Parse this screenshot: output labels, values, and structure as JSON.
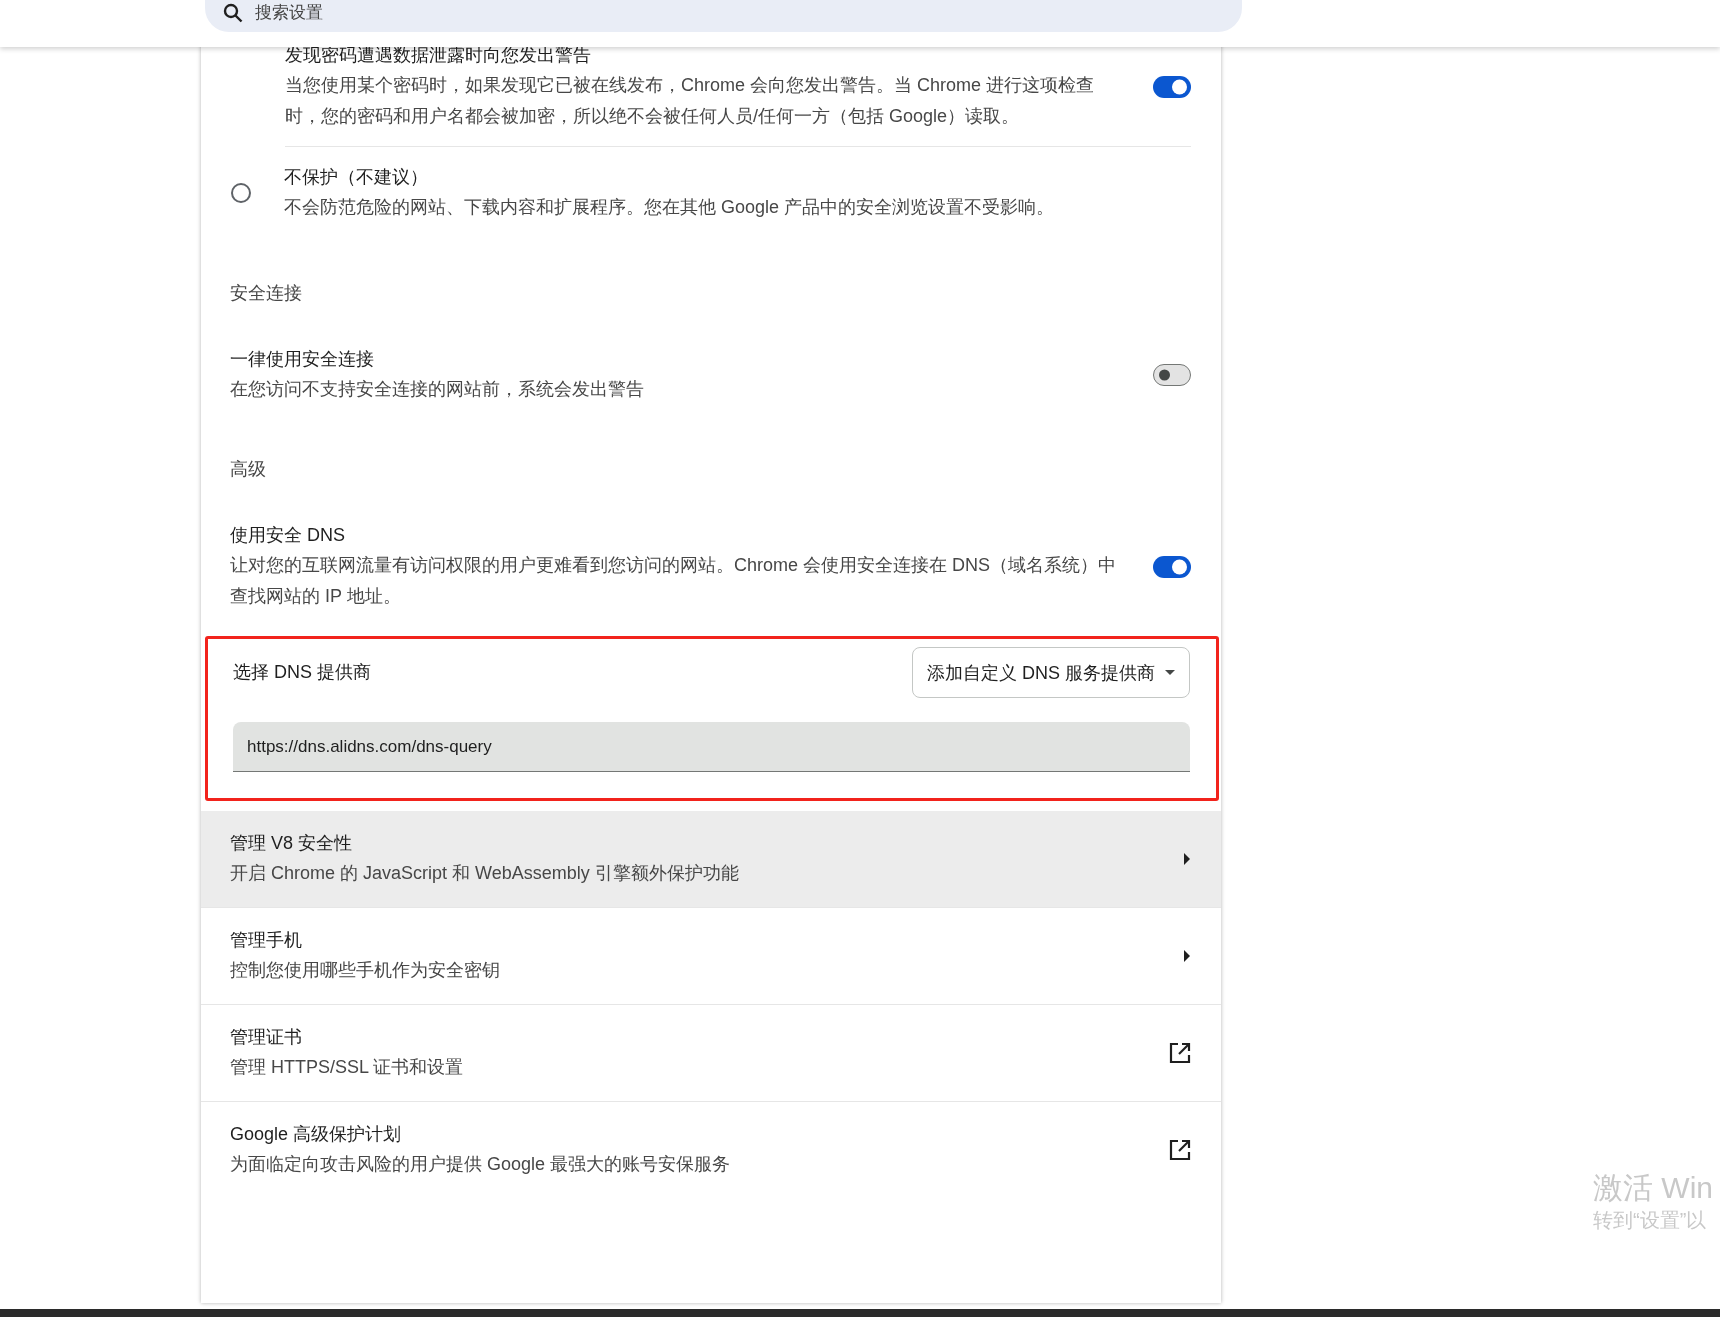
{
  "search": {
    "placeholder": "搜索设置"
  },
  "items": [
    {
      "kind": "toggle",
      "indented": true,
      "title": "发现密码遭遇数据泄露时向您发出警告",
      "description": "当您使用某个密码时，如果发现它已被在线发布，Chrome 会向您发出警告。当 Chrome 进行这项检查时，您的密码和用户名都会被加密，所以绝不会被任何人员/任何一方（包括 Google）读取。",
      "on": true
    },
    {
      "kind": "radio",
      "title": "不保护（不建议）",
      "description": "不会防范危险的网站、下载内容和扩展程序。您在其他 Google 产品中的安全浏览设置不受影响。",
      "selected": false
    },
    {
      "kind": "heading",
      "title": "安全连接"
    },
    {
      "kind": "toggle",
      "indented": false,
      "title": "一律使用安全连接",
      "description": "在您访问不支持安全连接的网站前，系统会发出警告",
      "on": false
    },
    {
      "kind": "heading",
      "title": "高级"
    },
    {
      "kind": "toggle",
      "indented": false,
      "title": "使用安全 DNS",
      "description": "让对您的互联网流量有访问权限的用户更难看到您访问的网站。Chrome 会使用安全连接在 DNS（域名系统）中查找网站的 IP 地址。",
      "on": true
    },
    {
      "kind": "dns",
      "annotated": true,
      "label": "选择 DNS 提供商",
      "dropdown": "添加自定义 DNS 服务提供商",
      "value": "https://dns.alidns.com/dns-query"
    },
    {
      "kind": "arrow_link",
      "highlighted": true,
      "title": "管理 V8 安全性",
      "description": "开启 Chrome 的 JavaScript 和 WebAssembly 引擎额外保护功能"
    },
    {
      "kind": "arrow_link",
      "highlighted": false,
      "title": "管理手机",
      "description": "控制您使用哪些手机作为安全密钥"
    },
    {
      "kind": "external_link",
      "highlighted": false,
      "title": "管理证书",
      "description": "管理 HTTPS/SSL 证书和设置"
    },
    {
      "kind": "external_link",
      "highlighted": false,
      "title": "Google 高级保护计划",
      "description": "为面临定向攻击风险的用户提供 Google 最强大的账号安保服务"
    }
  ],
  "activation_notice": {
    "title": "激活 Win",
    "subtitle": "转到“设置”以"
  }
}
